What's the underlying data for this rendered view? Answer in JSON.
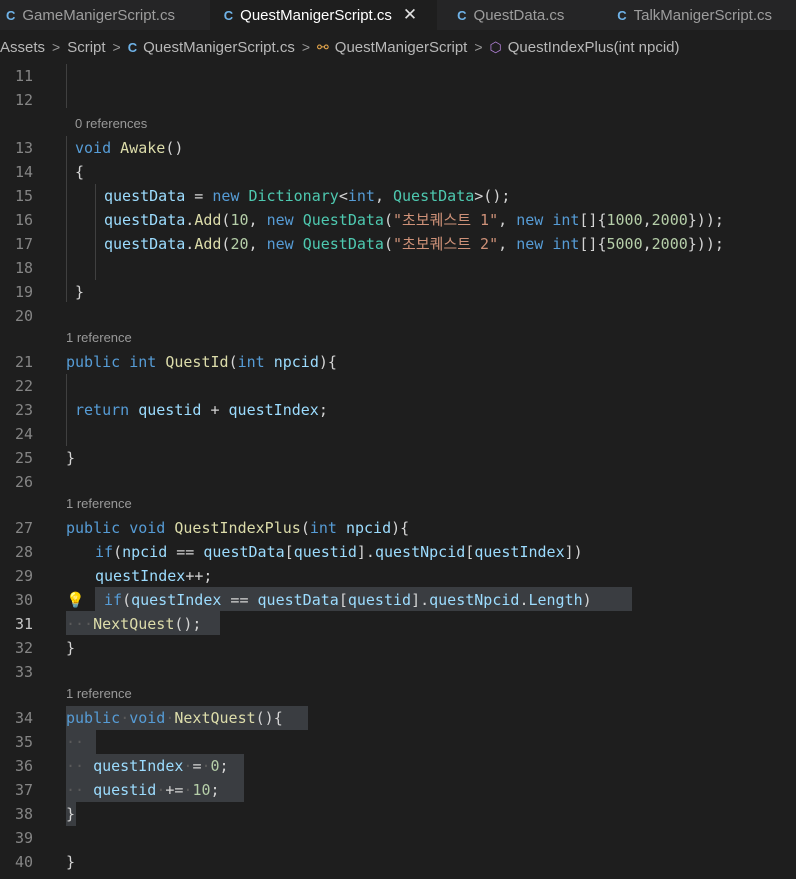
{
  "tabs": [
    {
      "icon": "csharp-file-icon",
      "label": "GameManigerScript.cs",
      "active": false
    },
    {
      "icon": "csharp-file-icon",
      "label": "QuestManigerScript.cs",
      "active": true
    },
    {
      "icon": "csharp-file-icon",
      "label": "QuestData.cs",
      "active": false
    },
    {
      "icon": "csharp-file-icon",
      "label": "TalkManigerScript.cs",
      "active": false
    }
  ],
  "breadcrumb": {
    "items": [
      "Assets",
      "Script",
      "QuestManigerScript.cs",
      "QuestManigerScript",
      "QuestIndexPlus(int npcid)"
    ]
  },
  "editor": {
    "current_line": "31",
    "lines": [
      {
        "num": "11"
      },
      {
        "num": "12"
      },
      {
        "num": "13",
        "lens": "0 references"
      },
      {
        "num": "14"
      },
      {
        "num": "15"
      },
      {
        "num": "16"
      },
      {
        "num": "17"
      },
      {
        "num": "18"
      },
      {
        "num": "19"
      },
      {
        "num": "20"
      },
      {
        "num": "21",
        "lens": "1 reference"
      },
      {
        "num": "22"
      },
      {
        "num": "23"
      },
      {
        "num": "24"
      },
      {
        "num": "25"
      },
      {
        "num": "26"
      },
      {
        "num": "27",
        "lens": "1 reference"
      },
      {
        "num": "28"
      },
      {
        "num": "29"
      },
      {
        "num": "30"
      },
      {
        "num": "31"
      },
      {
        "num": "32"
      },
      {
        "num": "33"
      },
      {
        "num": "34",
        "lens": "1 reference"
      },
      {
        "num": "35"
      },
      {
        "num": "36"
      },
      {
        "num": "37"
      },
      {
        "num": "38"
      },
      {
        "num": "39"
      },
      {
        "num": "40"
      }
    ]
  },
  "colors": {
    "keyword": "#569cd6",
    "type": "#4ec9b0",
    "function": "#dcdcaa",
    "variable": "#9cdcfe",
    "string": "#ce9178",
    "number": "#b5cea8"
  }
}
